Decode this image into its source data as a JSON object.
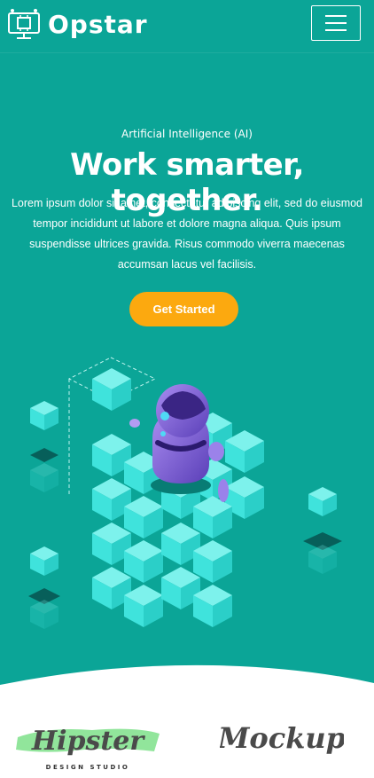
{
  "brand": {
    "name": "Opstar"
  },
  "nav": {
    "menu_icon": "hamburger-icon"
  },
  "hero": {
    "eyebrow": "Artificial Intelligence (AI)",
    "headline": "Work smarter, together.",
    "lead": "Lorem ipsum dolor sit amet, consectetur adipiscing elit, sed do eiusmod tempor incididunt ut labore et dolore magna aliqua. Quis ipsum suspendisse ultrices gravida. Risus commodo viverra maecenas accumsan lacus vel facilisis.",
    "cta_label": "Get Started"
  },
  "partners": {
    "hipster_title": "Hipster",
    "hipster_sub": "DESIGN STUDIO",
    "mockup_title": "Mockup"
  },
  "colors": {
    "hero_bg": "#0ba597",
    "accent": "#fca90f",
    "cube": "#3fe3dc",
    "robot": "#8a6fdc"
  }
}
